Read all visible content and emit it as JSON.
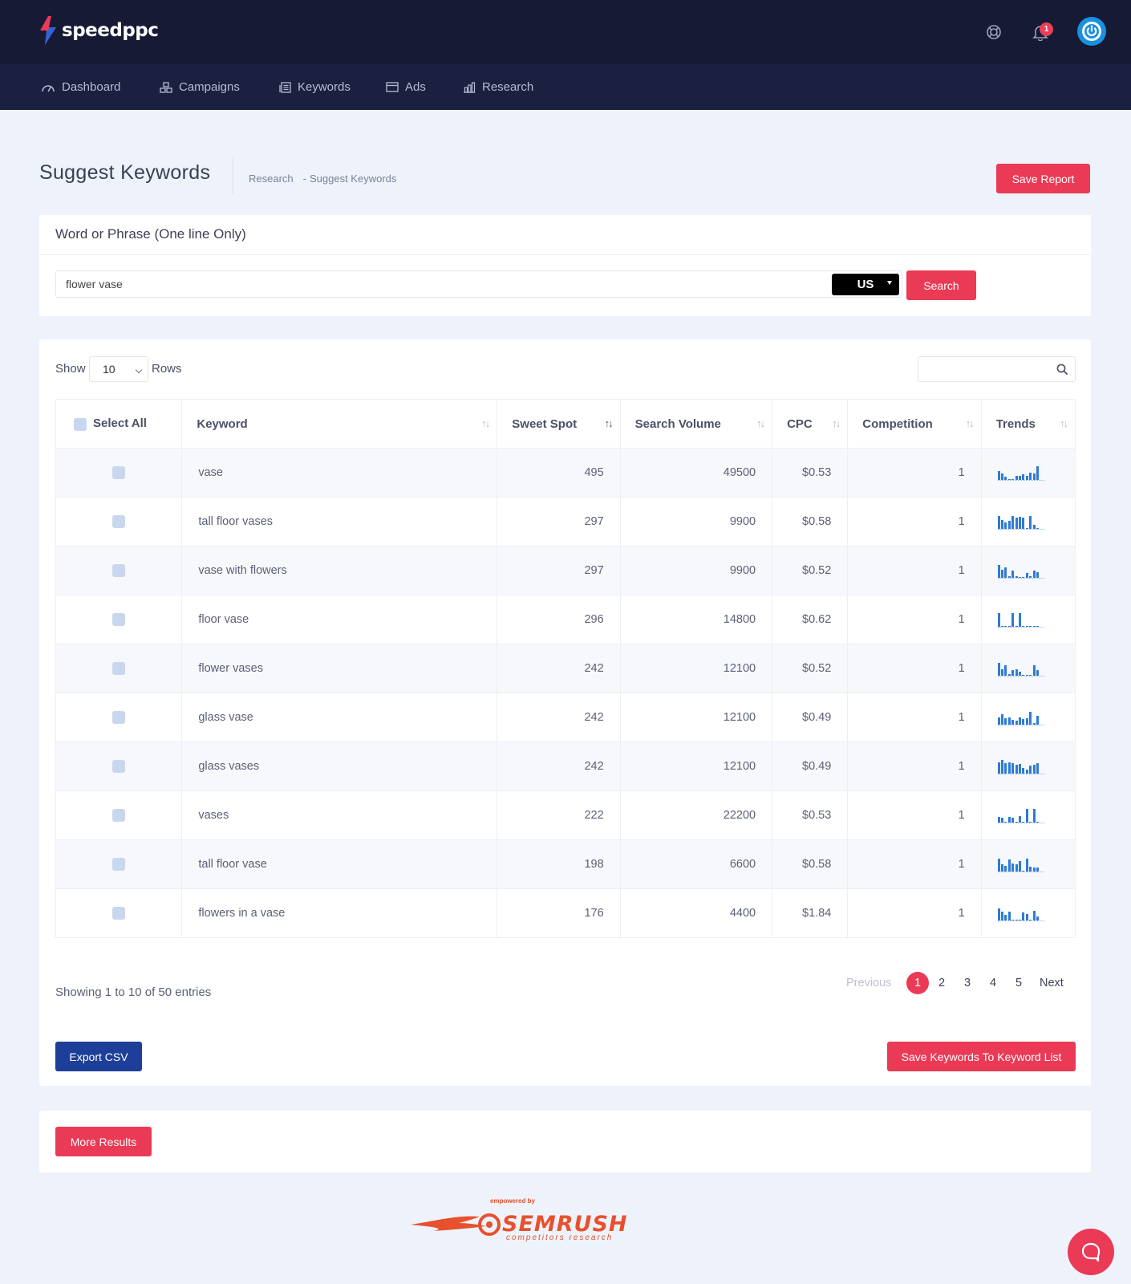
{
  "app": {
    "brand": "speedppc",
    "notification_count": "1"
  },
  "nav": [
    {
      "label": "Dashboard",
      "icon": "gauge-icon"
    },
    {
      "label": "Campaigns",
      "icon": "campaigns-icon"
    },
    {
      "label": "Keywords",
      "icon": "keywords-icon"
    },
    {
      "label": "Ads",
      "icon": "ads-icon"
    },
    {
      "label": "Research",
      "icon": "research-icon"
    }
  ],
  "page": {
    "title": "Suggest Keywords",
    "breadcrumb": [
      "Research",
      "Suggest Keywords"
    ],
    "breadcrumb_sep": "-",
    "save_report": "Save Report"
  },
  "search": {
    "label": "Word or Phrase (One line Only)",
    "value": "flower vase",
    "country": "US",
    "button": "Search"
  },
  "table": {
    "show_label": "Show",
    "rows_value": "10",
    "rows_label": "Rows",
    "columns": [
      "Select All",
      "Keyword",
      "Sweet Spot",
      "Search Volume",
      "CPC",
      "Competition",
      "Trends"
    ],
    "sorted_column": "Sweet Spot",
    "rows": [
      {
        "keyword": "vase",
        "sweet_spot": "495",
        "volume": "49500",
        "cpc": "$0.53",
        "competition": "1",
        "trend": [
          0.6,
          0.45,
          0.2,
          0.05,
          0.05,
          0.3,
          0.25,
          0.4,
          0.3,
          0.5,
          0.45,
          0.95
        ]
      },
      {
        "keyword": "tall floor vases",
        "sweet_spot": "297",
        "volume": "9900",
        "cpc": "$0.58",
        "competition": "1",
        "trend": [
          0.9,
          0.6,
          0.45,
          0.55,
          0.9,
          0.8,
          0.85,
          0.8,
          0.05,
          0.9,
          0.3,
          0.05
        ]
      },
      {
        "keyword": "vase with flowers",
        "sweet_spot": "297",
        "volume": "9900",
        "cpc": "$0.52",
        "competition": "1",
        "trend": [
          0.9,
          0.55,
          0.7,
          0.1,
          0.5,
          0.1,
          0.05,
          0.05,
          0.35,
          0.1,
          0.5,
          0.4
        ]
      },
      {
        "keyword": "floor vase",
        "sweet_spot": "296",
        "volume": "14800",
        "cpc": "$0.62",
        "competition": "1",
        "trend": [
          0.95,
          0.05,
          0.05,
          0.05,
          0.95,
          0.05,
          0.95,
          0.05,
          0.05,
          0.05,
          0.05,
          0.05
        ]
      },
      {
        "keyword": "flower vases",
        "sweet_spot": "242",
        "volume": "12100",
        "cpc": "$0.52",
        "competition": "1",
        "trend": [
          0.9,
          0.45,
          0.7,
          0.1,
          0.4,
          0.45,
          0.25,
          0.05,
          0.05,
          0.05,
          0.7,
          0.4
        ]
      },
      {
        "keyword": "glass vase",
        "sweet_spot": "242",
        "volume": "12100",
        "cpc": "$0.49",
        "competition": "1",
        "trend": [
          0.5,
          0.7,
          0.45,
          0.5,
          0.35,
          0.3,
          0.5,
          0.4,
          0.45,
          0.9,
          0.1,
          0.6
        ]
      },
      {
        "keyword": "glass vases",
        "sweet_spot": "242",
        "volume": "12100",
        "cpc": "$0.49",
        "competition": "1",
        "trend": [
          0.75,
          0.95,
          0.7,
          0.75,
          0.7,
          0.6,
          0.65,
          0.4,
          0.3,
          0.55,
          0.6,
          0.7
        ]
      },
      {
        "keyword": "vases",
        "sweet_spot": "222",
        "volume": "22200",
        "cpc": "$0.53",
        "competition": "1",
        "trend": [
          0.4,
          0.35,
          0.05,
          0.4,
          0.35,
          0.05,
          0.45,
          0.05,
          0.95,
          0.05,
          0.95,
          0.05
        ]
      },
      {
        "keyword": "tall floor vase",
        "sweet_spot": "198",
        "volume": "6600",
        "cpc": "$0.58",
        "competition": "1",
        "trend": [
          0.9,
          0.5,
          0.4,
          0.85,
          0.55,
          0.5,
          0.7,
          0.05,
          0.9,
          0.35,
          0.3,
          0.3
        ]
      },
      {
        "keyword": "flowers in a vase",
        "sweet_spot": "176",
        "volume": "4400",
        "cpc": "$1.84",
        "competition": "1",
        "trend": [
          0.85,
          0.6,
          0.4,
          0.6,
          0.05,
          0.05,
          0.05,
          0.55,
          0.45,
          0.05,
          0.65,
          0.3
        ]
      }
    ]
  },
  "footer": {
    "showing": "Showing 1 to 10 of 50 entries",
    "previous": "Previous",
    "pages": [
      "1",
      "2",
      "3",
      "4",
      "5"
    ],
    "current_page": "1",
    "next": "Next",
    "export_csv": "Export CSV",
    "save_keywords": "Save Keywords To Keyword List",
    "more_results": "More Results"
  },
  "semrush": {
    "top": "empowered by",
    "brand": "SEMRUSH",
    "tagline": "competitors research"
  },
  "colors": {
    "topbar": "#161a34",
    "navbar": "#1b2040",
    "accent_red": "#ea3a55",
    "accent_blue": "#1e3f99",
    "trend_bar": "#2f7bd2",
    "semrush": "#e8502e"
  }
}
